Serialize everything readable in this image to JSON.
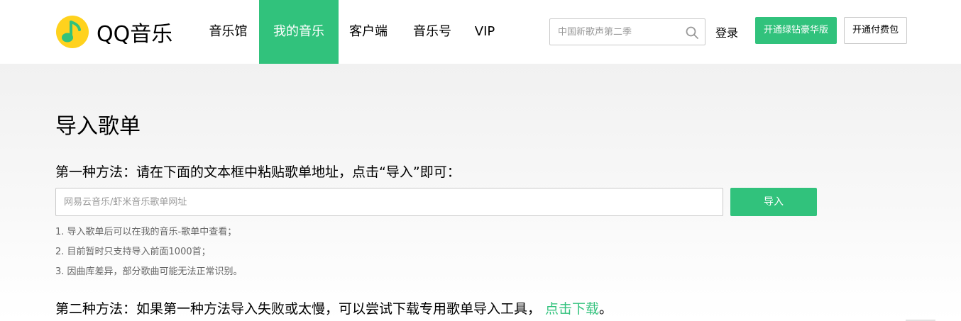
{
  "header": {
    "logo_text": "QQ音乐",
    "nav": [
      {
        "label": "音乐馆",
        "active": false
      },
      {
        "label": "我的音乐",
        "active": true
      },
      {
        "label": "客户端",
        "active": false
      },
      {
        "label": "音乐号",
        "active": false
      },
      {
        "label": "VIP",
        "active": false
      }
    ],
    "search": {
      "placeholder": "中国新歌声第二季",
      "icon": "search-icon"
    },
    "login_label": "登录",
    "vip_button_label": "开通绿钻豪华版",
    "pack_button_label": "开通付费包"
  },
  "main": {
    "title": "导入歌单",
    "method1": "第一种方法：请在下面的文本框中粘贴歌单地址，点击“导入”即可：",
    "url_input": {
      "placeholder": "网易云音乐/虾米音乐歌单网址",
      "value": ""
    },
    "import_button_label": "导入",
    "notes": [
      "1. 导入歌单后可以在我的音乐-歌单中查看；",
      "2. 目前暂时只支持导入前面1000首；",
      "3. 因曲库差异，部分歌曲可能无法正常识别。"
    ],
    "method2": "第二种方法：如果第一种方法导入失败或太慢，可以尝试下载专用歌单导入工具，",
    "download_link": "点击下载",
    "method2_end": "。"
  },
  "colors": {
    "accent": "#31c27c",
    "logo_yellow": "#ffd21e",
    "logo_green": "#31c27c"
  }
}
